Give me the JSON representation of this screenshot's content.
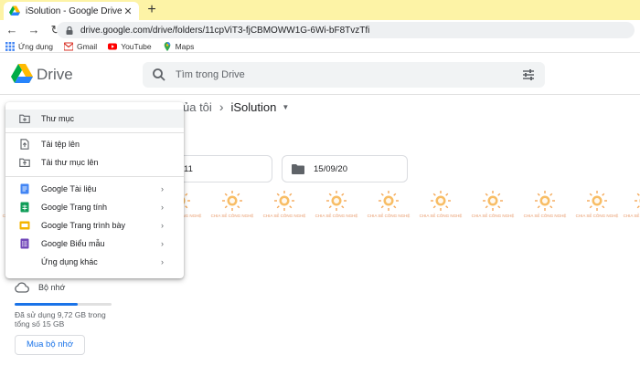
{
  "browser": {
    "tab_title": "iSolution - Google Drive",
    "url": "drive.google.com/drive/folders/11cpViT3-fjCBMOWW1G-6Wi-bF8TvzTfi",
    "bookmarks": [
      {
        "label": "Ứng dụng",
        "icon": "apps-grid-icon"
      },
      {
        "label": "Gmail",
        "icon": "gmail-icon"
      },
      {
        "label": "YouTube",
        "icon": "youtube-icon"
      },
      {
        "label": "Maps",
        "icon": "maps-pin-icon"
      }
    ]
  },
  "header": {
    "app_name": "Drive",
    "search_placeholder": "Tìm trong Drive"
  },
  "breadcrumb": {
    "parent": "ủa tôi",
    "current": "iSolution"
  },
  "folders": [
    {
      "name": "11"
    },
    {
      "name": "15/09/20"
    }
  ],
  "watermark": {
    "text": "CHIA SẺ CÔNG NGHỆ"
  },
  "menu": {
    "items": [
      {
        "label": "Thư mục",
        "icon": "new-folder-icon"
      },
      {
        "label": "Tải tệp lên",
        "icon": "file-upload-icon"
      },
      {
        "label": "Tải thư mục lên",
        "icon": "folder-upload-icon"
      },
      {
        "label": "Google Tài liệu",
        "icon": "docs-icon"
      },
      {
        "label": "Google Trang tính",
        "icon": "sheets-icon"
      },
      {
        "label": "Google Trang trình bày",
        "icon": "slides-icon"
      },
      {
        "label": "Google Biểu mẫu",
        "icon": "forms-icon"
      },
      {
        "label": "Ứng dụng khác",
        "icon": ""
      }
    ]
  },
  "storage": {
    "label": "Bộ nhớ",
    "usage_text": "Đã sử dụng 9,72 GB trong tổng số 15 GB",
    "used_fraction": 0.648,
    "buy_label": "Mua bộ nhớ"
  },
  "colors": {
    "tab_strip": "#fdf3a6",
    "accent": "#1a73e8",
    "docs": "#4285f4",
    "sheets": "#0f9d58",
    "slides": "#f4b400",
    "forms": "#7248b9"
  }
}
